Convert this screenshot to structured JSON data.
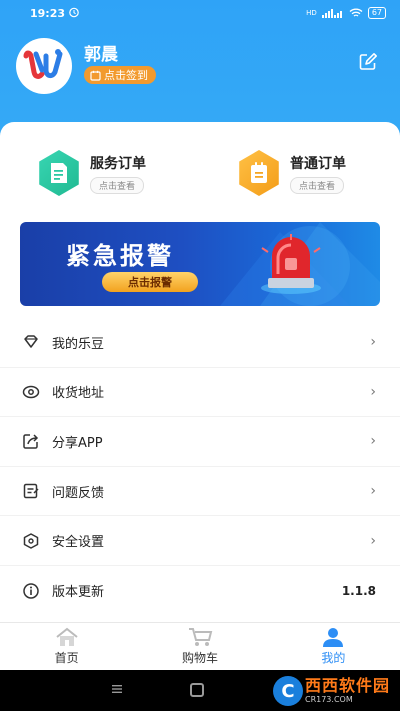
{
  "status_bar": {
    "time": "19:23",
    "signal": "HD",
    "battery": "67"
  },
  "profile": {
    "name": "郭晨",
    "checkin_label": "点击签到"
  },
  "orders": [
    {
      "title": "服务订单",
      "link": "点击查看",
      "color": "#2cc9a4"
    },
    {
      "title": "普通订单",
      "link": "点击查看",
      "color": "#f5a623"
    }
  ],
  "alarm": {
    "title": "紧急报警",
    "button_label": "点击报警"
  },
  "menu": [
    {
      "label": "我的乐豆",
      "icon": "diamond-icon"
    },
    {
      "label": "收货地址",
      "icon": "location-icon"
    },
    {
      "label": "分享APP",
      "icon": "share-icon"
    },
    {
      "label": "问题反馈",
      "icon": "feedback-icon"
    },
    {
      "label": "安全设置",
      "icon": "shield-icon"
    },
    {
      "label": "版本更新",
      "icon": "info-icon",
      "value": "1.1.8"
    }
  ],
  "tabs": [
    {
      "label": "首页",
      "icon": "home-icon"
    },
    {
      "label": "购物车",
      "icon": "cart-icon"
    },
    {
      "label": "我的",
      "icon": "user-icon",
      "active": true
    }
  ],
  "watermark": {
    "letter": "C",
    "main": "西西软件园",
    "sub": "CR173.COM"
  },
  "colors": {
    "header_blue": "#2fa3f7",
    "accent_orange": "#f29a2e",
    "active_tab": "#2d8ef5"
  }
}
